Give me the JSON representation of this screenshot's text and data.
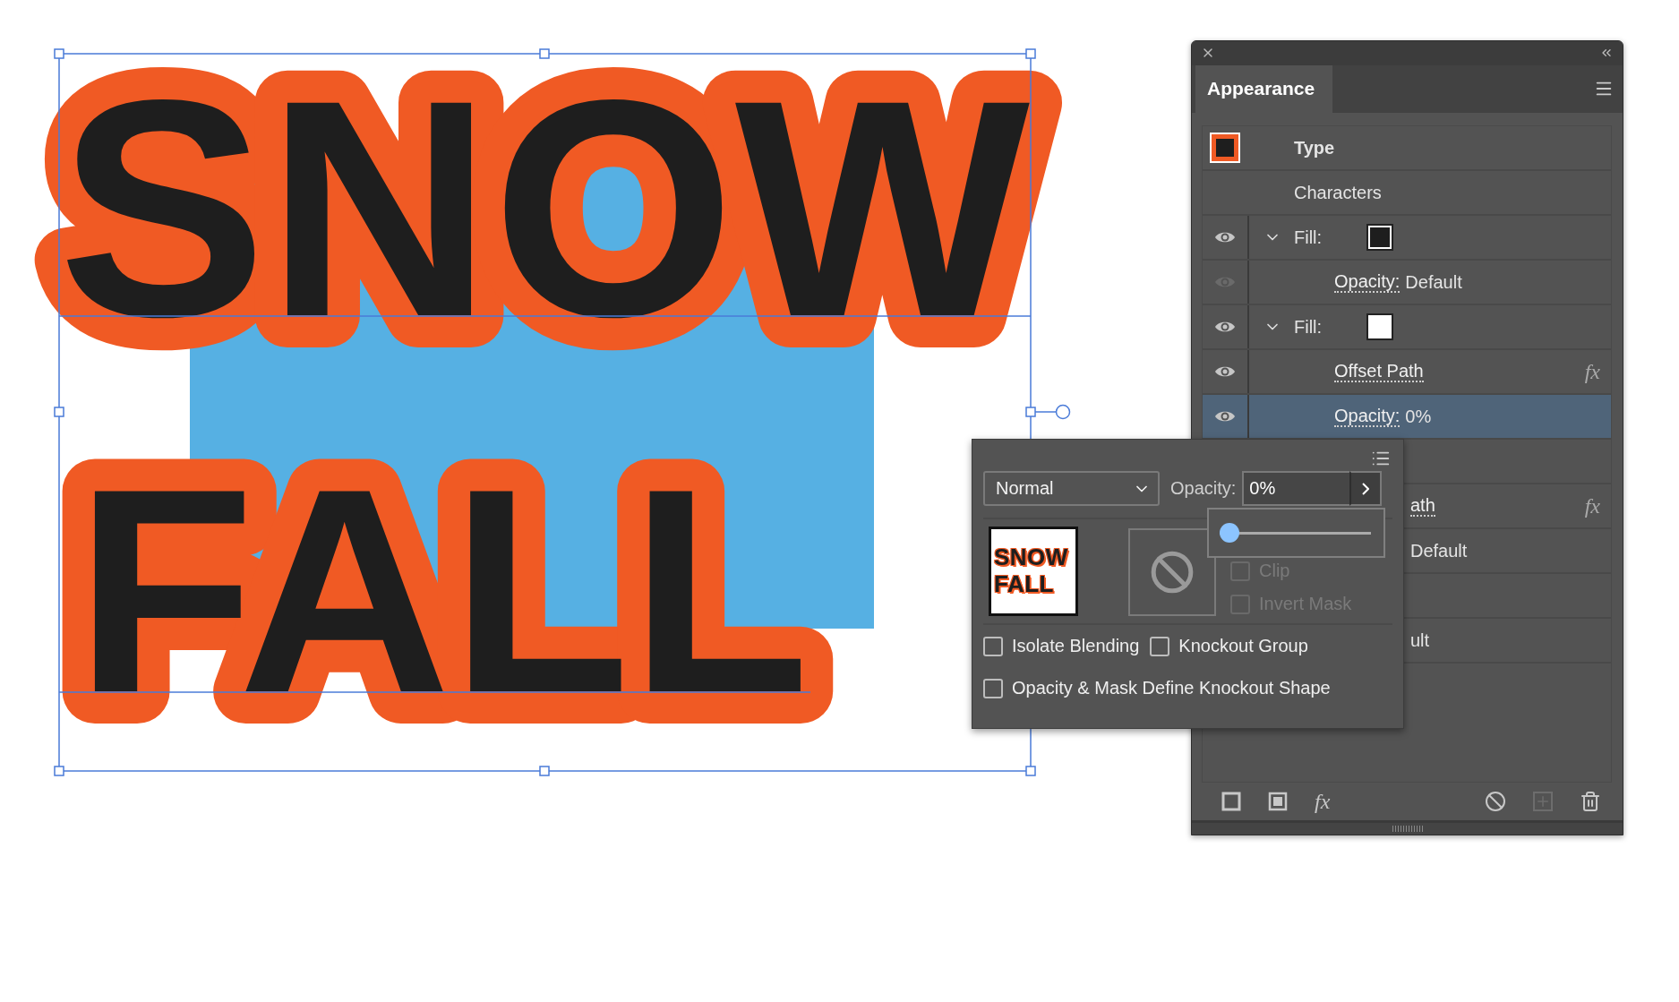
{
  "artwork": {
    "lines": [
      "SNOW",
      "FALL"
    ]
  },
  "appearance_panel": {
    "tab": {
      "label": "Appearance",
      "selected": true
    },
    "rows": [
      {
        "kind": "object",
        "label": "Type",
        "selected": false
      },
      {
        "kind": "plain",
        "label": "Characters",
        "selected": false
      },
      {
        "kind": "fill",
        "label": "Fill:",
        "visible": true,
        "expanded": true,
        "color": "#1e1e1e",
        "selected": false
      },
      {
        "kind": "attribute",
        "label": "Opacity:",
        "value": "Default",
        "visible": false,
        "selected": false
      },
      {
        "kind": "fill",
        "label": "Fill:",
        "visible": true,
        "expanded": true,
        "color": "#ffffff",
        "selected": false
      },
      {
        "kind": "effect",
        "label": "Offset Path",
        "badge": "fx",
        "visible": true,
        "selected": false
      },
      {
        "kind": "attribute",
        "label": "Opacity:",
        "value": "0%",
        "visible": true,
        "selected": true
      },
      {
        "kind": "blank",
        "selected": false
      },
      {
        "kind": "partial",
        "text": "ath",
        "link": true,
        "badge": "fx",
        "selected": false
      },
      {
        "kind": "partial",
        "text": "Default",
        "link": false,
        "selected": false
      },
      {
        "kind": "blank",
        "selected": false
      },
      {
        "kind": "partial",
        "text": "ult",
        "link": false,
        "selected": false
      }
    ],
    "toolbar": [
      {
        "kind": "stroke",
        "disabled": false
      },
      {
        "kind": "fill",
        "disabled": false
      },
      {
        "kind": "effect",
        "label": "fx",
        "disabled": false
      },
      {
        "kind": "clear",
        "disabled": false
      },
      {
        "kind": "add",
        "disabled": true
      },
      {
        "kind": "delete",
        "disabled": false
      }
    ]
  },
  "transparency_popup": {
    "blend_mode": "Normal",
    "opacity_label": "Opacity:",
    "opacity_value": "0%",
    "slider": {
      "level": 0
    },
    "thumbnail": {
      "lines": [
        "SNOW",
        "FALL"
      ]
    },
    "mask_options": [
      {
        "label": "Clip",
        "checked": false,
        "disabled": true
      },
      {
        "label": "Invert Mask",
        "checked": false,
        "disabled": true
      }
    ],
    "options": [
      {
        "label": "Isolate Blending",
        "checked": false
      },
      {
        "label": "Knockout Group",
        "checked": false
      },
      {
        "label": "Opacity & Mask Define Knockout Shape",
        "checked": false
      }
    ]
  }
}
